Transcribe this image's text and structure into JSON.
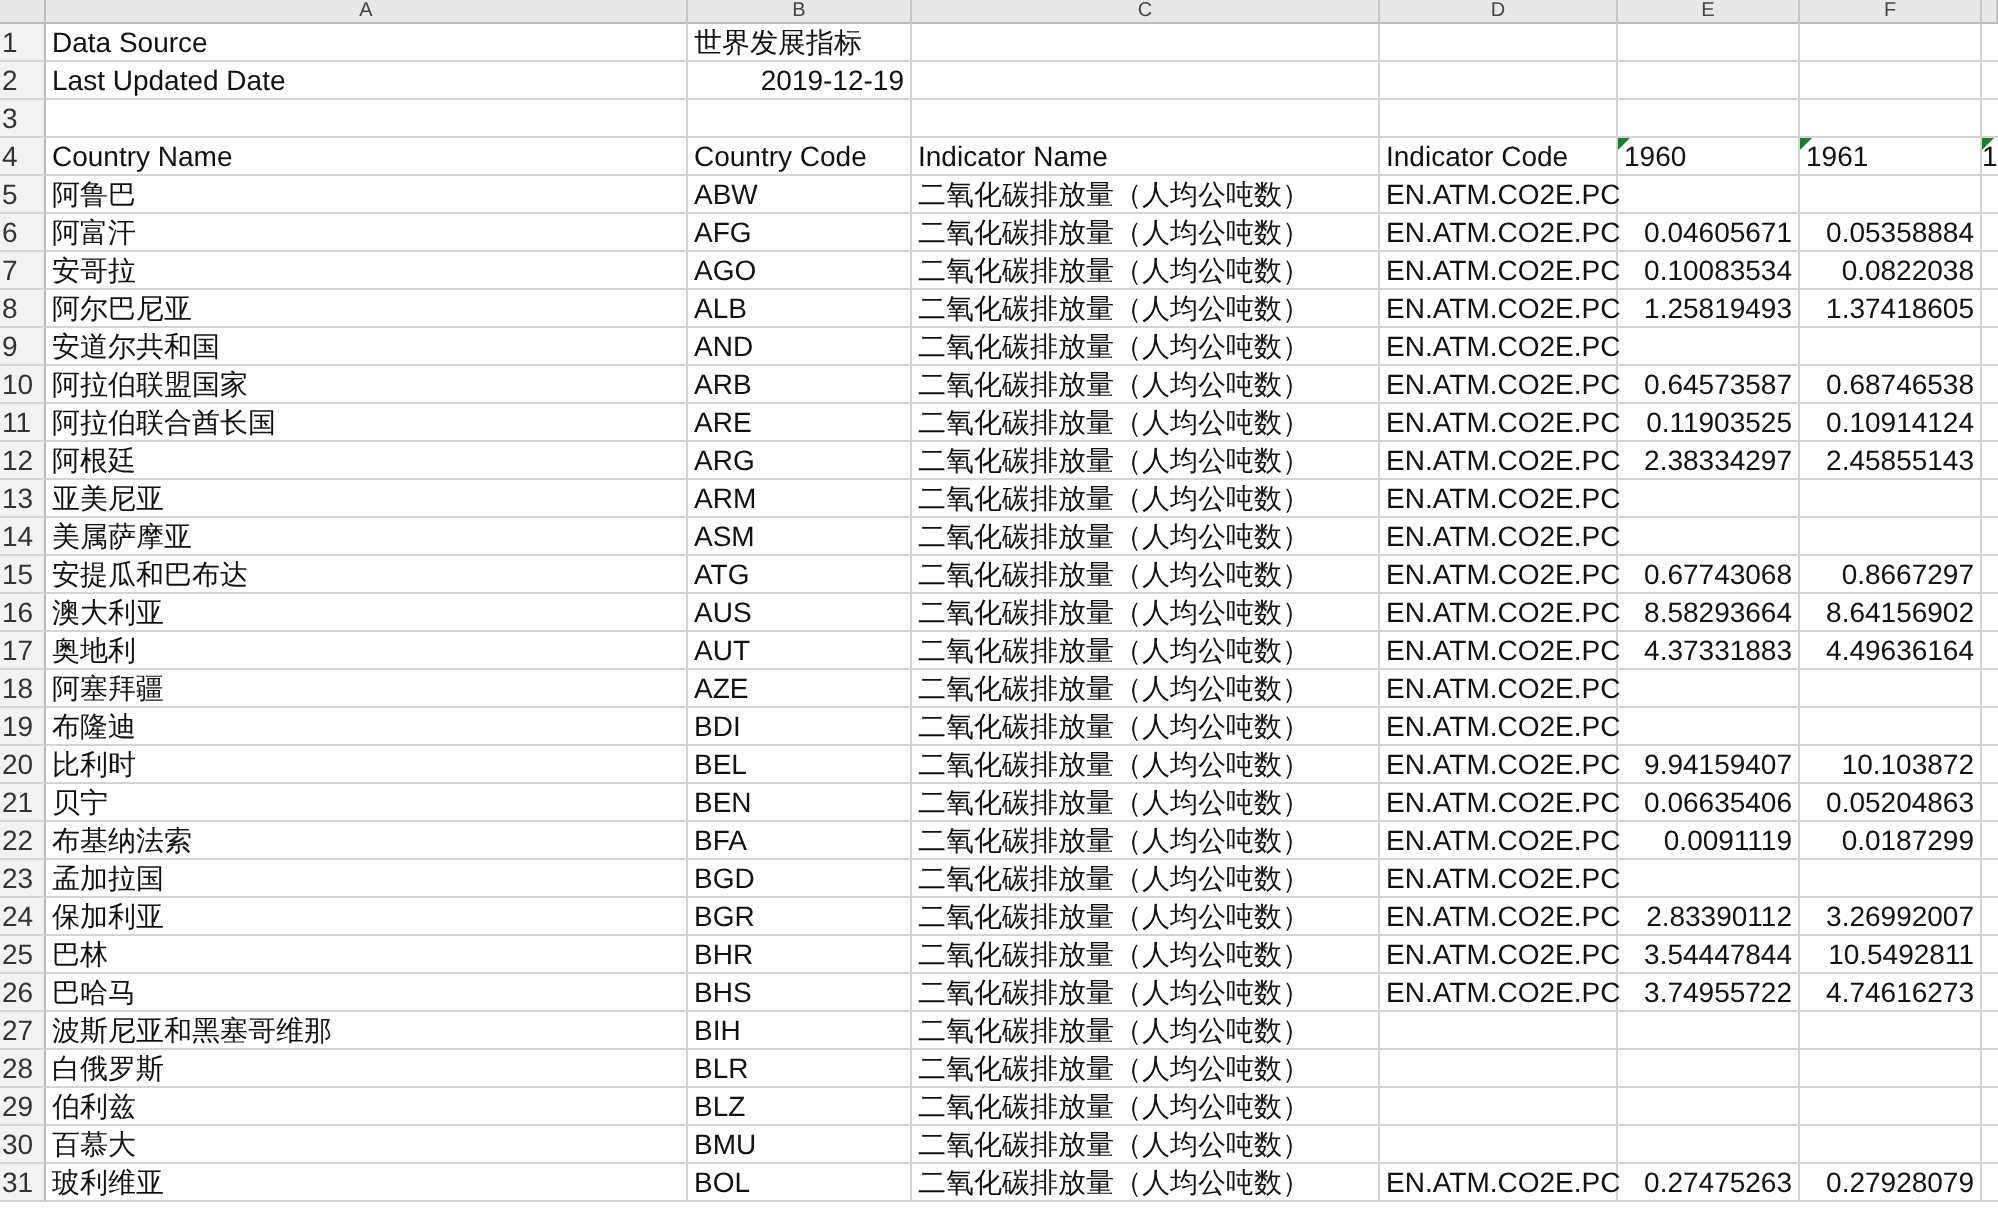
{
  "columns": [
    "A",
    "B",
    "C",
    "D",
    "E",
    "F"
  ],
  "rows": [
    {
      "number": "1",
      "cells": [
        "Data Source",
        "世界发展指标"
      ]
    },
    {
      "number": "2",
      "cells": [
        "Last Updated Date",
        {
          "text": "2019-12-19",
          "kind": "number"
        }
      ]
    },
    {
      "number": "3",
      "cells": []
    },
    {
      "number": "4",
      "cells": [
        "Country Name",
        "Country Code",
        "Indicator Name",
        "Indicator Code",
        {
          "text": "1960",
          "kind": "flagged"
        },
        {
          "text": "1961",
          "kind": "flagged"
        },
        {
          "text": "1",
          "kind": "flagged"
        }
      ]
    },
    {
      "number": "5",
      "cells": [
        "阿鲁巴",
        "ABW",
        "二氧化碳排放量（人均公吨数）",
        "EN.ATM.CO2E.PC"
      ]
    },
    {
      "number": "6",
      "cells": [
        "阿富汗",
        "AFG",
        "二氧化碳排放量（人均公吨数）",
        "EN.ATM.CO2E.PC",
        {
          "text": "0.04605671",
          "kind": "number"
        },
        {
          "text": "0.05358884",
          "kind": "number"
        }
      ]
    },
    {
      "number": "7",
      "cells": [
        "安哥拉",
        "AGO",
        "二氧化碳排放量（人均公吨数）",
        "EN.ATM.CO2E.PC",
        {
          "text": "0.10083534",
          "kind": "number"
        },
        {
          "text": "0.0822038",
          "kind": "number"
        }
      ]
    },
    {
      "number": "8",
      "cells": [
        "阿尔巴尼亚",
        "ALB",
        "二氧化碳排放量（人均公吨数）",
        "EN.ATM.CO2E.PC",
        {
          "text": "1.25819493",
          "kind": "number"
        },
        {
          "text": "1.37418605",
          "kind": "number"
        }
      ]
    },
    {
      "number": "9",
      "cells": [
        "安道尔共和国",
        "AND",
        "二氧化碳排放量（人均公吨数）",
        "EN.ATM.CO2E.PC"
      ]
    },
    {
      "number": "10",
      "cells": [
        "阿拉伯联盟国家",
        "ARB",
        "二氧化碳排放量（人均公吨数）",
        "EN.ATM.CO2E.PC",
        {
          "text": "0.64573587",
          "kind": "number"
        },
        {
          "text": "0.68746538",
          "kind": "number"
        }
      ]
    },
    {
      "number": "11",
      "cells": [
        "阿拉伯联合酋长国",
        "ARE",
        "二氧化碳排放量（人均公吨数）",
        "EN.ATM.CO2E.PC",
        {
          "text": "0.11903525",
          "kind": "number"
        },
        {
          "text": "0.10914124",
          "kind": "number"
        }
      ]
    },
    {
      "number": "12",
      "cells": [
        "阿根廷",
        "ARG",
        "二氧化碳排放量（人均公吨数）",
        "EN.ATM.CO2E.PC",
        {
          "text": "2.38334297",
          "kind": "number"
        },
        {
          "text": "2.45855143",
          "kind": "number"
        }
      ]
    },
    {
      "number": "13",
      "cells": [
        "亚美尼亚",
        "ARM",
        "二氧化碳排放量（人均公吨数）",
        "EN.ATM.CO2E.PC"
      ]
    },
    {
      "number": "14",
      "cells": [
        "美属萨摩亚",
        "ASM",
        "二氧化碳排放量（人均公吨数）",
        "EN.ATM.CO2E.PC"
      ]
    },
    {
      "number": "15",
      "cells": [
        "安提瓜和巴布达",
        "ATG",
        "二氧化碳排放量（人均公吨数）",
        "EN.ATM.CO2E.PC",
        {
          "text": "0.67743068",
          "kind": "number"
        },
        {
          "text": "0.8667297",
          "kind": "number"
        }
      ]
    },
    {
      "number": "16",
      "cells": [
        "澳大利亚",
        "AUS",
        "二氧化碳排放量（人均公吨数）",
        "EN.ATM.CO2E.PC",
        {
          "text": "8.58293664",
          "kind": "number"
        },
        {
          "text": "8.64156902",
          "kind": "number"
        }
      ]
    },
    {
      "number": "17",
      "cells": [
        "奥地利",
        "AUT",
        "二氧化碳排放量（人均公吨数）",
        "EN.ATM.CO2E.PC",
        {
          "text": "4.37331883",
          "kind": "number"
        },
        {
          "text": "4.49636164",
          "kind": "number"
        }
      ]
    },
    {
      "number": "18",
      "cells": [
        "阿塞拜疆",
        "AZE",
        "二氧化碳排放量（人均公吨数）",
        "EN.ATM.CO2E.PC"
      ]
    },
    {
      "number": "19",
      "cells": [
        "布隆迪",
        "BDI",
        "二氧化碳排放量（人均公吨数）",
        "EN.ATM.CO2E.PC"
      ]
    },
    {
      "number": "20",
      "cells": [
        "比利时",
        "BEL",
        "二氧化碳排放量（人均公吨数）",
        "EN.ATM.CO2E.PC",
        {
          "text": "9.94159407",
          "kind": "number"
        },
        {
          "text": "10.103872",
          "kind": "number"
        }
      ]
    },
    {
      "number": "21",
      "cells": [
        "贝宁",
        "BEN",
        "二氧化碳排放量（人均公吨数）",
        "EN.ATM.CO2E.PC",
        {
          "text": "0.06635406",
          "kind": "number"
        },
        {
          "text": "0.05204863",
          "kind": "number"
        }
      ]
    },
    {
      "number": "22",
      "cells": [
        "布基纳法索",
        "BFA",
        "二氧化碳排放量（人均公吨数）",
        "EN.ATM.CO2E.PC",
        {
          "text": "0.0091119",
          "kind": "number"
        },
        {
          "text": "0.0187299",
          "kind": "number"
        }
      ]
    },
    {
      "number": "23",
      "cells": [
        "孟加拉国",
        "BGD",
        "二氧化碳排放量（人均公吨数）",
        "EN.ATM.CO2E.PC"
      ]
    },
    {
      "number": "24",
      "cells": [
        "保加利亚",
        "BGR",
        "二氧化碳排放量（人均公吨数）",
        "EN.ATM.CO2E.PC",
        {
          "text": "2.83390112",
          "kind": "number"
        },
        {
          "text": "3.26992007",
          "kind": "number"
        }
      ]
    },
    {
      "number": "25",
      "cells": [
        "巴林",
        "BHR",
        "二氧化碳排放量（人均公吨数）",
        "EN.ATM.CO2E.PC",
        {
          "text": "3.54447844",
          "kind": "number"
        },
        {
          "text": "10.5492811",
          "kind": "number"
        }
      ]
    },
    {
      "number": "26",
      "cells": [
        "巴哈马",
        "BHS",
        "二氧化碳排放量（人均公吨数）",
        "EN.ATM.CO2E.PC",
        {
          "text": "3.74955722",
          "kind": "number"
        },
        {
          "text": "4.74616273",
          "kind": "number"
        }
      ]
    },
    {
      "number": "27",
      "cells": [
        "波斯尼亚和黑塞哥维那",
        "BIH",
        "二氧化碳排放量（人均公吨数）"
      ]
    },
    {
      "number": "28",
      "cells": [
        "白俄罗斯",
        "BLR",
        "二氧化碳排放量（人均公吨数）"
      ]
    },
    {
      "number": "29",
      "cells": [
        "伯利兹",
        "BLZ",
        "二氧化碳排放量（人均公吨数）"
      ]
    },
    {
      "number": "30",
      "cells": [
        "百慕大",
        "BMU",
        "二氧化碳排放量（人均公吨数）"
      ]
    },
    {
      "number": "31",
      "cells": [
        "玻利维亚",
        "BOL",
        "二氧化碳排放量（人均公吨数）",
        "EN.ATM.CO2E.PC",
        {
          "text": "0.27475263",
          "kind": "number"
        },
        {
          "text": "0.27928079",
          "kind": "number"
        }
      ]
    }
  ]
}
